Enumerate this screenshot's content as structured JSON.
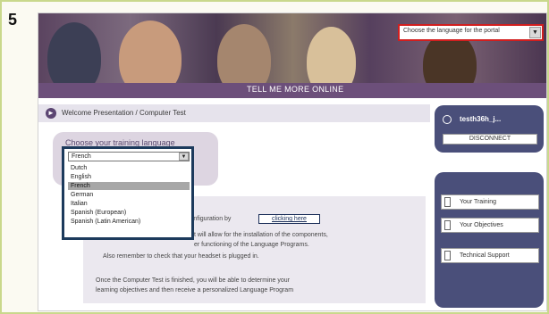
{
  "step": {
    "number": "5"
  },
  "header": {
    "banner_title": "TELL ME MORE ONLINE",
    "language_selector": "Choose the language for the portal"
  },
  "breadcrumb": {
    "text": "Welcome Presentation / Computer Test"
  },
  "user": {
    "name": "testh36h_j...",
    "disconnect_label": "DISCONNECT"
  },
  "menu": {
    "items": [
      {
        "label": "Your Training"
      },
      {
        "label": "Your Objectives"
      },
      {
        "label": "Technical Support"
      }
    ]
  },
  "training": {
    "title": "Choose your training language",
    "selected_value": "French",
    "options": [
      {
        "label": "Dutch",
        "selected": false
      },
      {
        "label": "English",
        "selected": false
      },
      {
        "label": "French",
        "selected": true
      },
      {
        "label": "German",
        "selected": false
      },
      {
        "label": "Italian",
        "selected": false
      },
      {
        "label": "Spanish (European)",
        "selected": false
      },
      {
        "label": "Spanish (Latin American)",
        "selected": false
      }
    ]
  },
  "info": {
    "line1": "configuration by",
    "link": "clicking here",
    "line2": "t will allow for the installation of the components,",
    "line3": "er functioning of the Language Programs.",
    "line4": "Also remember to check that your headset is plugged in.",
    "line5": "Once the Computer Test is finished, you will be able to determine your",
    "line6": "learning objectives and then receive a personalized Language Program"
  },
  "colors": {
    "frame_border": "#c9d88c",
    "panel_purple": "#4a4f7a",
    "highlight_red": "#d11f1f",
    "highlight_navy": "#1c3a5c"
  }
}
